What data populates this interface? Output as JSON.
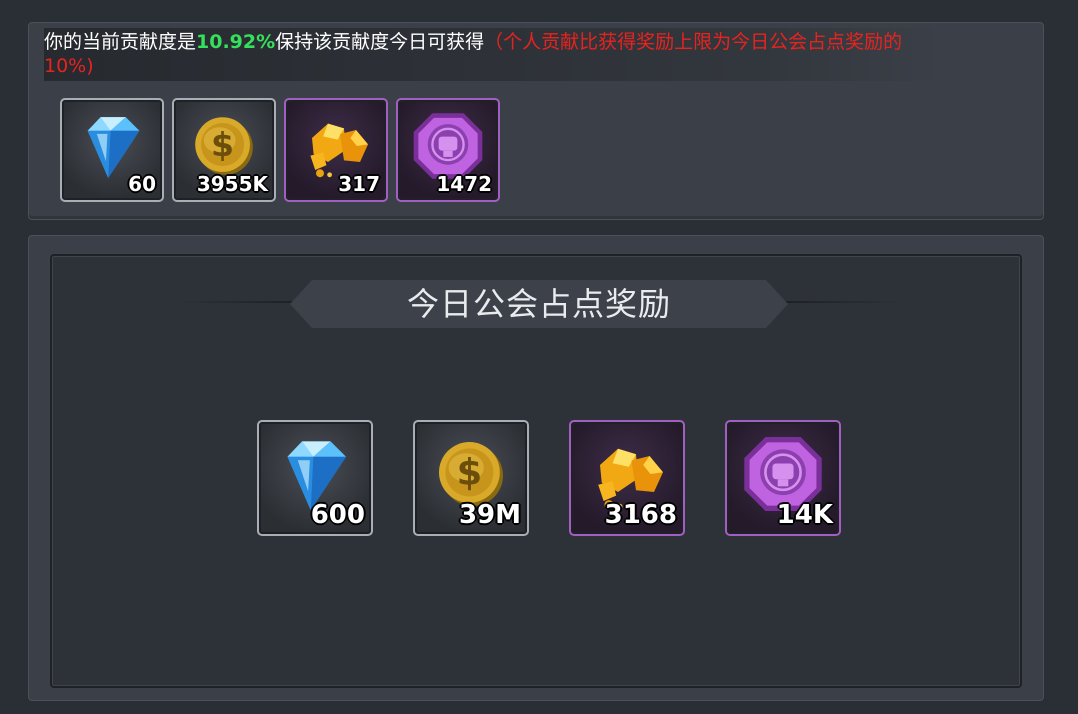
{
  "contribution": {
    "prefix": "你的当前贡献度是",
    "percent": "10.92%",
    "suffix": "保持该贡献度今日可获得",
    "note": "（个人贡献比获得奖励上限为今日公会占点奖励的10%)"
  },
  "current_rewards": [
    {
      "icon": "diamond-icon",
      "count": "60"
    },
    {
      "icon": "gold-coin-icon",
      "count": "3955K"
    },
    {
      "icon": "gold-ore-icon",
      "count": "317"
    },
    {
      "icon": "purple-fist-token-icon",
      "count": "1472"
    }
  ],
  "guild_section": {
    "title": "今日公会占点奖励",
    "rewards": [
      {
        "icon": "diamond-icon",
        "count": "600"
      },
      {
        "icon": "gold-coin-icon",
        "count": "39M"
      },
      {
        "icon": "gold-ore-icon",
        "count": "3168"
      },
      {
        "icon": "purple-fist-token-icon",
        "count": "14K"
      }
    ]
  },
  "colors": {
    "percent": "#35e05a",
    "note": "#e8231e",
    "purple_frame": "#a45ec3",
    "gray_frame": "#a9aeb4"
  }
}
